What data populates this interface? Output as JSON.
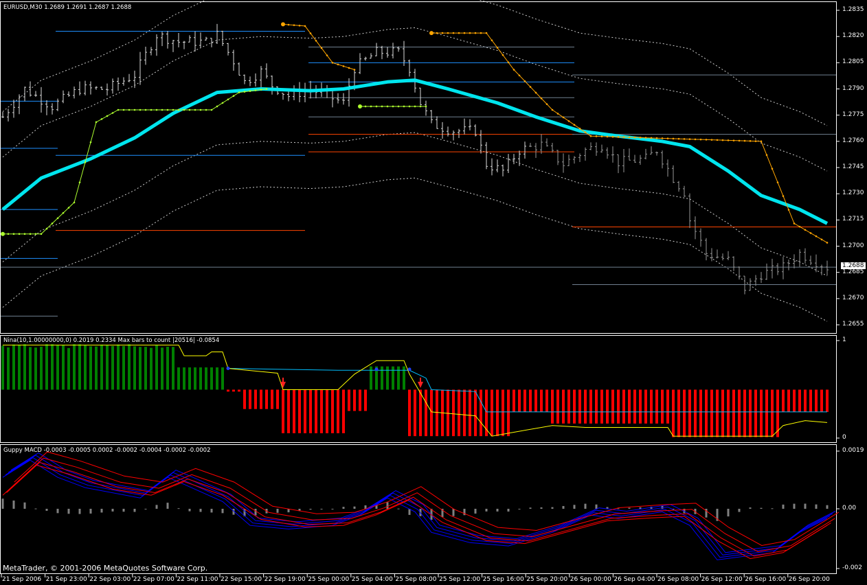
{
  "main_title": "EURUSD,M30  1.2689 1.2691 1.2687 1.2688",
  "nina_title": "Nina(10,1.00000000,0) 0.2019 0.2334  Max bars to count  |20516|   -0.0854",
  "macd_title": "Guppy MACD -0.0003 -0.0005 0.0002 -0.0002 -0.0004 -0.0002 -0.0002",
  "copyright": "MetaTrader, © 2001-2006 MetaQuotes Software Corp.",
  "current_price": "1.2688",
  "colors": {
    "ma": "#00e5ee",
    "stop_up": "#adff2f",
    "stop_down": "#ffa500",
    "bull": "#008000",
    "bear": "#ff0000",
    "blue_level": "#1e90ff",
    "red_level": "#ff4500",
    "gray_level": "#708090",
    "macd_fast": "#0000ff",
    "macd_slow": "#ff0000",
    "hist": "#808080"
  },
  "chart_data": [
    {
      "type": "line",
      "title": "EURUSD,M30",
      "ylim": [
        1.265,
        1.2842
      ],
      "y_ticks": [
        "1.2835",
        "1.2820",
        "1.2805",
        "1.2790",
        "1.2775",
        "1.2760",
        "1.2745",
        "1.2730",
        "1.2715",
        "1.2700",
        "1.2685",
        "1.2670",
        "1.2655"
      ],
      "x_ticks": [
        "21 Sep 2006",
        "21 Sep 23:00",
        "22 Sep 03:00",
        "22 Sep 07:00",
        "22 Sep 11:00",
        "22 Sep 15:00",
        "22 Sep 19:00",
        "25 Sep 00:00",
        "25 Sep 04:00",
        "25 Sep 08:00",
        "25 Sep 12:00",
        "25 Sep 16:00",
        "25 Sep 20:00",
        "26 Sep 00:00",
        "26 Sep 04:00",
        "26 Sep 08:00",
        "26 Sep 12:00",
        "26 Sep 16:00",
        "26 Sep 20:00"
      ],
      "bars_count": 151,
      "close_keypoints": [
        [
          0,
          1.2774
        ],
        [
          4,
          1.279
        ],
        [
          9,
          1.278
        ],
        [
          14,
          1.279
        ],
        [
          19,
          1.279
        ],
        [
          24,
          1.2798
        ],
        [
          28,
          1.2821
        ],
        [
          32,
          1.2817
        ],
        [
          37,
          1.2817
        ],
        [
          39,
          1.2821
        ],
        [
          42,
          1.2806
        ],
        [
          44,
          1.2794
        ],
        [
          47,
          1.28
        ],
        [
          49,
          1.2792
        ],
        [
          52,
          1.2786
        ],
        [
          56,
          1.279
        ],
        [
          59,
          1.2786
        ],
        [
          62,
          1.2782
        ],
        [
          64,
          1.2802
        ],
        [
          68,
          1.2811
        ],
        [
          72,
          1.2811
        ],
        [
          74,
          1.2802
        ],
        [
          76,
          1.2782
        ],
        [
          78,
          1.277
        ],
        [
          82,
          1.2766
        ],
        [
          86,
          1.2766
        ],
        [
          88,
          1.2747
        ],
        [
          91,
          1.2743
        ],
        [
          94,
          1.2755
        ],
        [
          98,
          1.2758
        ],
        [
          102,
          1.2747
        ],
        [
          106,
          1.2755
        ],
        [
          109,
          1.2758
        ],
        [
          112,
          1.2748
        ],
        [
          117,
          1.275
        ],
        [
          119,
          1.2755
        ],
        [
          122,
          1.2739
        ],
        [
          124,
          1.2731
        ],
        [
          125,
          1.2715
        ],
        [
          128,
          1.2696
        ],
        [
          132,
          1.2692
        ],
        [
          135,
          1.2676
        ],
        [
          138,
          1.2684
        ],
        [
          142,
          1.2688
        ],
        [
          145,
          1.2696
        ],
        [
          150,
          1.2688
        ]
      ],
      "ma_keypoints": [
        [
          0,
          1.2721
        ],
        [
          7,
          1.2739
        ],
        [
          16,
          1.275
        ],
        [
          24,
          1.2762
        ],
        [
          31,
          1.2776
        ],
        [
          39,
          1.2788
        ],
        [
          47,
          1.279
        ],
        [
          56,
          1.2789
        ],
        [
          62,
          1.279
        ],
        [
          70,
          1.2794
        ],
        [
          75,
          1.2795
        ],
        [
          81,
          1.279
        ],
        [
          90,
          1.2782
        ],
        [
          97,
          1.2774
        ],
        [
          105,
          1.2766
        ],
        [
          112,
          1.2763
        ],
        [
          120,
          1.276
        ],
        [
          125,
          1.2757
        ],
        [
          132,
          1.2743
        ],
        [
          138,
          1.2729
        ],
        [
          145,
          1.2721
        ],
        [
          150,
          1.2713
        ]
      ],
      "band_offsets": [
        0.003,
        0.0056
      ],
      "levels": [
        {
          "price": 1.2823,
          "from": 10,
          "to": 55,
          "kind": "blue"
        },
        {
          "price": 1.2783,
          "from": 0,
          "to": 10,
          "kind": "blue"
        },
        {
          "price": 1.2756,
          "from": 0,
          "to": 10,
          "kind": "blue"
        },
        {
          "price": 1.2752,
          "from": 10,
          "to": 55,
          "kind": "blue"
        },
        {
          "price": 1.2721,
          "from": 0,
          "to": 10,
          "kind": "blue"
        },
        {
          "price": 1.2709,
          "from": 10,
          "to": 55,
          "kind": "red"
        },
        {
          "price": 1.2693,
          "from": 0,
          "to": 10,
          "kind": "blue"
        },
        {
          "price": 1.266,
          "from": 0,
          "to": 10,
          "kind": "gray"
        },
        {
          "price": 1.2814,
          "from": 56,
          "to": 104,
          "kind": "gray"
        },
        {
          "price": 1.2805,
          "from": 56,
          "to": 104,
          "kind": "blue"
        },
        {
          "price": 1.2794,
          "from": 56,
          "to": 104,
          "kind": "blue"
        },
        {
          "price": 1.2785,
          "from": 56,
          "to": 104,
          "kind": "gray"
        },
        {
          "price": 1.2774,
          "from": 56,
          "to": 104,
          "kind": "gray"
        },
        {
          "price": 1.2764,
          "from": 56,
          "to": 104,
          "kind": "red"
        },
        {
          "price": 1.2754,
          "from": 56,
          "to": 104,
          "kind": "red"
        },
        {
          "price": 1.2798,
          "from": 104,
          "to": 152,
          "kind": "gray"
        },
        {
          "price": 1.2764,
          "from": 104,
          "to": 152,
          "kind": "gray"
        },
        {
          "price": 1.2711,
          "from": 104,
          "to": 152,
          "kind": "red"
        },
        {
          "price": 1.2678,
          "from": 104,
          "to": 152,
          "kind": "gray"
        },
        {
          "price": 1.2688,
          "from": 0,
          "to": 152,
          "kind": "gray"
        }
      ],
      "stop_up": [
        [
          [
            0,
            1.2707
          ],
          [
            7,
            1.2707
          ],
          [
            13,
            1.2725
          ],
          [
            17,
            1.2771
          ],
          [
            21,
            1.2778
          ],
          [
            38,
            1.2778
          ],
          [
            43,
            1.2788
          ],
          [
            48,
            1.279
          ]
        ],
        [
          [
            65,
            1.278
          ],
          [
            77,
            1.278
          ]
        ]
      ],
      "stop_down": [
        [
          [
            51,
            1.2827
          ],
          [
            55,
            1.2826
          ],
          [
            60,
            1.2805
          ],
          [
            64,
            1.2801
          ]
        ],
        [
          [
            78,
            1.2822
          ],
          [
            88,
            1.2822
          ],
          [
            93,
            1.2801
          ],
          [
            100,
            1.2778
          ],
          [
            107,
            1.2763
          ],
          [
            138,
            1.276
          ],
          [
            144,
            1.2713
          ],
          [
            150,
            1.2702
          ]
        ]
      ]
    },
    {
      "type": "bar",
      "title": "Nina",
      "ylim": [
        0,
        1
      ],
      "y_ticks": [
        "1",
        "0"
      ],
      "baseline": 0.5,
      "histogram_segments": [
        [
          0,
          31,
          0.97
        ],
        [
          32,
          40,
          0.73
        ],
        [
          41,
          43,
          0.48
        ],
        [
          44,
          50,
          0.3
        ],
        [
          51,
          62,
          0.05
        ],
        [
          63,
          66,
          0.28
        ],
        [
          67,
          73,
          0.74
        ],
        [
          74,
          92,
          0.02
        ],
        [
          93,
          99,
          0.27
        ],
        [
          100,
          121,
          0.15
        ],
        [
          122,
          141,
          0.01
        ],
        [
          142,
          150,
          0.27
        ]
      ],
      "yellow_line": [
        [
          0,
          0.96
        ],
        [
          32,
          0.96
        ],
        [
          33,
          0.85
        ],
        [
          37,
          0.85
        ],
        [
          38,
          0.89
        ],
        [
          40,
          0.89
        ],
        [
          41,
          0.72
        ],
        [
          50,
          0.67
        ],
        [
          51,
          0.5
        ],
        [
          61,
          0.5
        ],
        [
          64,
          0.66
        ],
        [
          68,
          0.8
        ],
        [
          73,
          0.8
        ],
        [
          74,
          0.66
        ],
        [
          78,
          0.27
        ],
        [
          86,
          0.23
        ],
        [
          89,
          0.02
        ],
        [
          93,
          0.06
        ],
        [
          100,
          0.13
        ],
        [
          106,
          0.11
        ],
        [
          121,
          0.11
        ],
        [
          122,
          0.02
        ],
        [
          140,
          0.02
        ],
        [
          142,
          0.13
        ],
        [
          146,
          0.18
        ],
        [
          150,
          0.16
        ]
      ],
      "cyan_line": [
        [
          41,
          0.72
        ],
        [
          61,
          0.7
        ],
        [
          68,
          0.7
        ],
        [
          74,
          0.7
        ],
        [
          77,
          0.62
        ],
        [
          78,
          0.5
        ],
        [
          86,
          0.48
        ],
        [
          88,
          0.27
        ],
        [
          150,
          0.27
        ]
      ],
      "down_arrows": [
        51,
        76
      ],
      "dots": [
        [
          41,
          0.72
        ],
        [
          68,
          0.71
        ],
        [
          74,
          0.71
        ]
      ]
    },
    {
      "type": "line",
      "title": "Guppy MACD",
      "ylim": [
        -0.0021,
        0.0021
      ],
      "y_ticks": [
        "0.0019",
        "0.00",
        "-0.002"
      ],
      "fast": [
        [
          0,
          0.00116
        ],
        [
          5,
          0.00173
        ],
        [
          10,
          0.00116
        ],
        [
          15,
          0.00082
        ],
        [
          25,
          0.00048
        ],
        [
          30,
          0.00116
        ],
        [
          33,
          0.00093
        ],
        [
          40,
          0.00036
        ],
        [
          45,
          -0.00043
        ],
        [
          52,
          -0.00055
        ],
        [
          60,
          -0.00043
        ],
        [
          65,
          -9e-05
        ],
        [
          70,
          0.00048
        ],
        [
          75,
          2e-05
        ],
        [
          78,
          -0.00066
        ],
        [
          85,
          -0.001
        ],
        [
          92,
          -0.00111
        ],
        [
          100,
          -0.00066
        ],
        [
          107,
          -9e-05
        ],
        [
          112,
          -0.0002
        ],
        [
          120,
          2e-05
        ],
        [
          125,
          -0.00043
        ],
        [
          130,
          -0.00157
        ],
        [
          135,
          -0.00145
        ],
        [
          140,
          -0.00134
        ],
        [
          145,
          -0.00066
        ],
        [
          150,
          -0.0002
        ]
      ],
      "slow": [
        [
          0,
          0.0006
        ],
        [
          6,
          0.0016
        ],
        [
          12,
          0.0013
        ],
        [
          20,
          0.0008
        ],
        [
          27,
          0.0006
        ],
        [
          33,
          0.00105
        ],
        [
          40,
          0.0006
        ],
        [
          47,
          -0.0002
        ],
        [
          55,
          -0.00045
        ],
        [
          62,
          -0.0004
        ],
        [
          68,
          -5e-05
        ],
        [
          74,
          0.00045
        ],
        [
          80,
          -0.0003
        ],
        [
          88,
          -0.0009
        ],
        [
          95,
          -0.001
        ],
        [
          103,
          -0.0006
        ],
        [
          110,
          -0.00025
        ],
        [
          118,
          -0.00015
        ],
        [
          124,
          -0.0001
        ],
        [
          130,
          -0.0009
        ],
        [
          136,
          -0.0015
        ],
        [
          142,
          -0.0013
        ],
        [
          150,
          -0.0004
        ]
      ]
    }
  ]
}
